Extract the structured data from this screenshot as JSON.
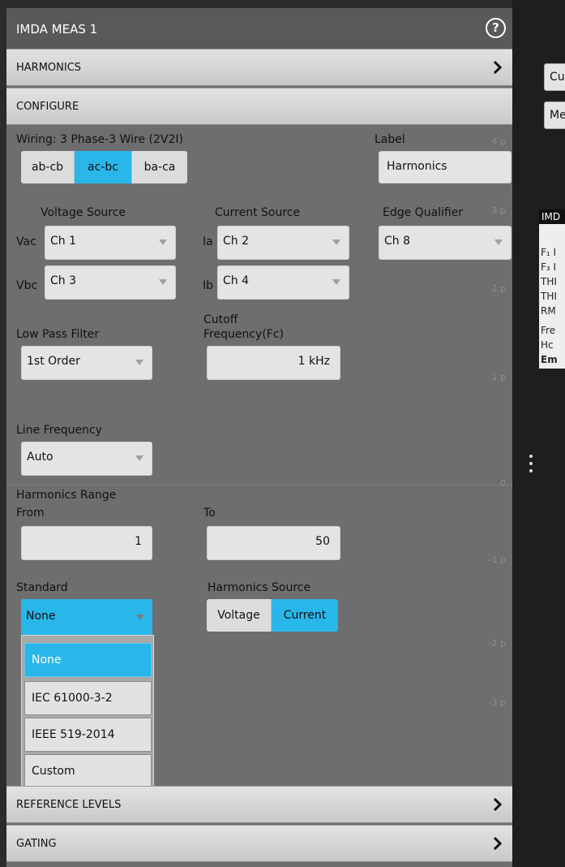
{
  "window": {
    "title": "IMDA MEAS 1",
    "help_icon": "help-circle-icon",
    "help_glyph": "?"
  },
  "sections": {
    "harmonics": "HARMONICS",
    "configure": "CONFIGURE",
    "reference_levels": "REFERENCE LEVELS",
    "gating": "GATING"
  },
  "configure": {
    "wiring_label": "Wiring: 3 Phase-3 Wire (2V2I)",
    "wiring_options": [
      "ab-cb",
      "ac-bc",
      "ba-ca"
    ],
    "wiring_selected": "ac-bc",
    "label_heading": "Label",
    "label_value": "Harmonics",
    "voltage_source_heading": "Voltage Source",
    "current_source_heading": "Current Source",
    "edge_qualifier_heading": "Edge Qualifier",
    "vac": {
      "prefix": "Vac",
      "value": "Ch 1"
    },
    "vbc": {
      "prefix": "Vbc",
      "value": "Ch 3"
    },
    "ia": {
      "prefix": "Ia",
      "value": "Ch 2"
    },
    "ib": {
      "prefix": "Ib",
      "value": "Ch 4"
    },
    "edge_qualifier_value": "Ch 8",
    "low_pass_filter_label": "Low Pass Filter",
    "low_pass_filter_value": "1st Order",
    "cutoff_label_1": "Cutoff",
    "cutoff_label_2": "Frequency(Fc)",
    "cutoff_value": "1 kHz",
    "line_frequency_label": "Line Frequency",
    "line_frequency_value": "Auto",
    "harmonics_range_label": "Harmonics Range",
    "from_label": "From",
    "from_value": "1",
    "to_label": "To",
    "to_value": "50",
    "standard_label": "Standard",
    "standard_value": "None",
    "standard_options": [
      "None",
      "IEC 61000-3-2",
      "IEEE 519-2014",
      "Custom"
    ],
    "standard_selected": "None",
    "harmonics_source_label": "Harmonics Source",
    "harmonics_source_options": [
      "Voltage",
      "Current"
    ],
    "harmonics_source_selected": "Current"
  },
  "background_axis": {
    "ticks": [
      "4 p",
      "3 p",
      "2 p",
      "1 p",
      "0",
      "-1 p",
      "-2 p",
      "-3 p"
    ]
  },
  "right_pane": {
    "button_1": "Cu",
    "button_2": "Me",
    "meas_header": "IMD",
    "rows": [
      "F₁ I",
      "F₃ I",
      "THI",
      "THI",
      "RM",
      "Fre",
      "Hᴄ",
      "Em"
    ]
  },
  "colors": {
    "accent": "#29b7ea",
    "panel_bg": "#6e6e6e",
    "title_bg": "#595959"
  }
}
